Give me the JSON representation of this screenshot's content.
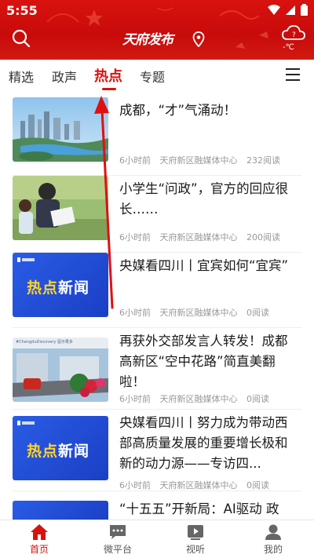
{
  "status_bar": {
    "time": "5:55"
  },
  "header": {
    "logo_text": "天府发布",
    "weather_temp": "-℃",
    "accent_color": "#d8120e"
  },
  "tabs": [
    {
      "label": "精选",
      "active": false
    },
    {
      "label": "政声",
      "active": false
    },
    {
      "label": "热点",
      "active": true
    },
    {
      "label": "专题",
      "active": false
    }
  ],
  "news": [
    {
      "title": "成都，“才”气涌动！",
      "time": "6小时前",
      "source": "天府新区融媒体中心",
      "reads": "232阅读",
      "thumb": "city-skyline"
    },
    {
      "title": "小学生“问政”，官方的回应很长……",
      "time": "6小时前",
      "source": "天府新区融媒体中心",
      "reads": "200阅读",
      "thumb": "children-reading"
    },
    {
      "title": "央媒看四川丨宜宾如何“宜宾”",
      "time": "6小时前",
      "source": "天府新区融媒体中心",
      "reads": "0阅读",
      "thumb": "hot-news-banner",
      "thumb_text_a": "热点",
      "thumb_text_b": "新闻"
    },
    {
      "title": "再获外交部发言人转发！成都高新区“空中花路”简直美翻啦！",
      "time": "6小时前",
      "source": "天府新区融媒体中心",
      "reads": "0阅读",
      "thumb": "flower-road",
      "thumb_caption": "#ChengduDiscovery 留示果多"
    },
    {
      "title": "央媒看四川丨努力成为带动西部高质量发展的重要增长极和新的动力源——专访四...",
      "time": "6小时前",
      "source": "天府新区融媒体中心",
      "reads": "0阅读",
      "thumb": "hot-news-banner",
      "thumb_text_a": "热点",
      "thumb_text_b": "新闻"
    },
    {
      "title": "“十五五”开新局：AI驱动 政",
      "thumb": "hot-news-banner"
    }
  ],
  "bottom_nav": [
    {
      "label": "首页",
      "icon": "home-icon",
      "active": true
    },
    {
      "label": "微平台",
      "icon": "chat-icon",
      "active": false
    },
    {
      "label": "视听",
      "icon": "video-icon",
      "active": false
    },
    {
      "label": "我的",
      "icon": "profile-icon",
      "active": false
    }
  ]
}
